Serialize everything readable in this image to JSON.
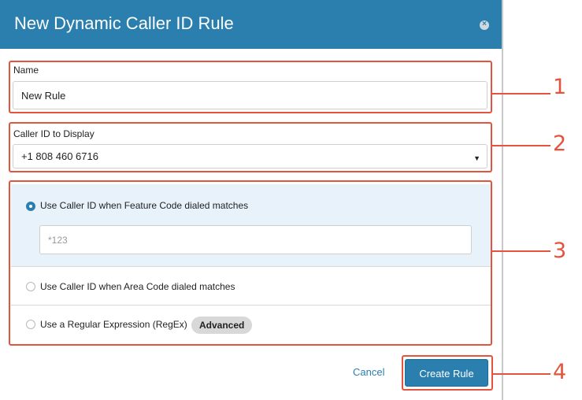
{
  "dialog": {
    "title": "New Dynamic Caller ID Rule",
    "close_icon": "close-icon"
  },
  "name_section": {
    "label": "Name",
    "value": "New Rule"
  },
  "caller_id_section": {
    "label": "Caller ID to Display",
    "selected": "+1 808 460 6716",
    "caret_icon": "caret-down-icon"
  },
  "match_options": [
    {
      "label": "Use Caller ID when Feature Code dialed matches",
      "selected": true,
      "input_placeholder": "*123"
    },
    {
      "label": "Use Caller ID when Area Code dialed matches",
      "selected": false
    },
    {
      "label": "Use a Regular Expression (RegEx)",
      "selected": false,
      "badge": "Advanced"
    }
  ],
  "footer": {
    "cancel_label": "Cancel",
    "create_label": "Create Rule"
  },
  "callouts": [
    "1",
    "2",
    "3",
    "4"
  ],
  "colors": {
    "header": "#2a7fae",
    "callout": "#e4533e",
    "active_option_bg": "#e8f2fb"
  }
}
